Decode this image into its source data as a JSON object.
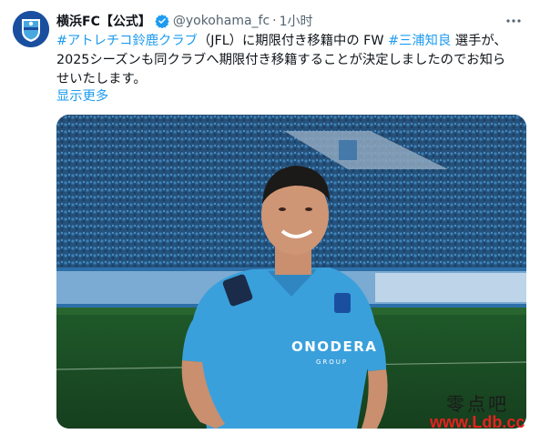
{
  "tweet": {
    "display_name": "横浜FC【公式】",
    "handle": "@yokohama_fc",
    "separator": "·",
    "time": "1小时",
    "text": {
      "hashtag_1": "#アトレチコ鈴鹿クラブ",
      "segment_1": "（JFL）に期限付き移籍中の FW",
      "hashtag_2": "#三浦知良",
      "segment_2": "選手が、",
      "line_2": "2025シーズンも同クラブへ期限付き移籍することが決定しましたのでお知ら",
      "line_3": "せいたします。"
    },
    "show_more": "显示更多"
  },
  "media": {
    "jersey_text": "ONODERA",
    "jersey_sub": "GROUP"
  },
  "watermark": {
    "chinese": "零点吧",
    "url": "www.Ldb.cc"
  },
  "colors": {
    "link": "#1d9bf0",
    "jersey": "#3aa0dc",
    "verified": "#1d9bf0"
  }
}
